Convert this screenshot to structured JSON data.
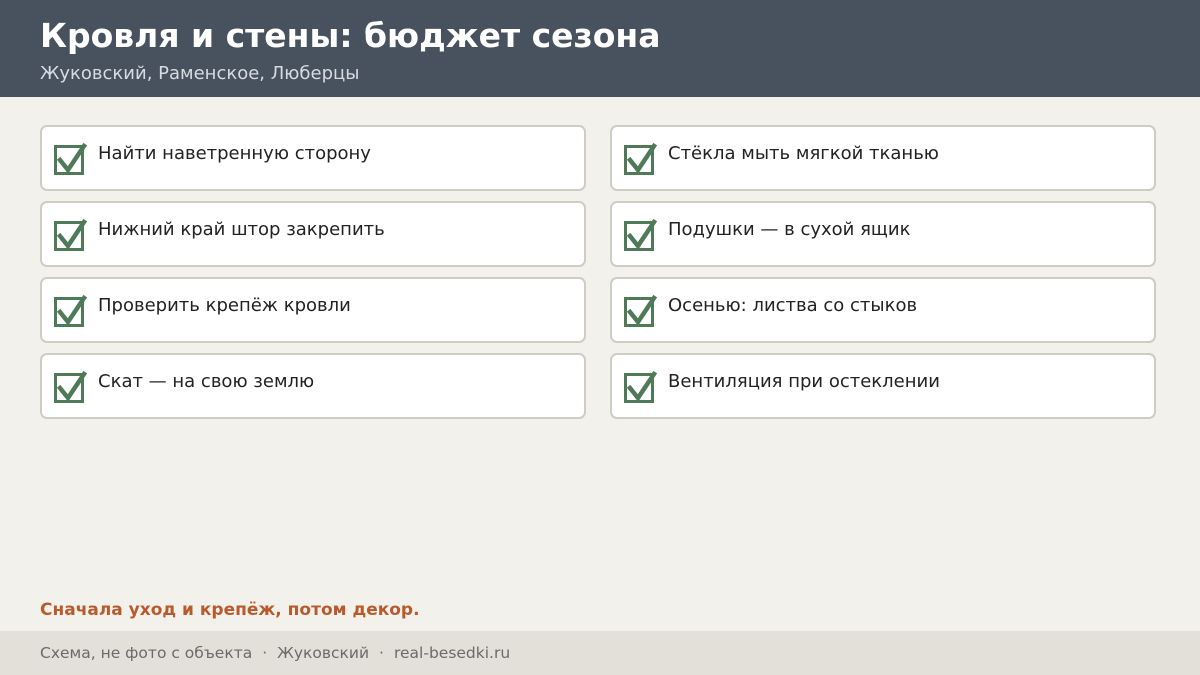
{
  "header": {
    "title": "Кровля и стены: бюджет сезона",
    "subtitle": "Жуковский, Раменское, Люберцы"
  },
  "checklist": {
    "items": [
      {
        "label": "Найти наветренную сторону",
        "checked": true
      },
      {
        "label": "Стёкла мыть мягкой тканью",
        "checked": true
      },
      {
        "label": "Нижний край штор закрепить",
        "checked": true
      },
      {
        "label": "Подушки — в сухой ящик",
        "checked": true
      },
      {
        "label": "Проверить крепёж кровли",
        "checked": true
      },
      {
        "label": "Осенью: листва со стыков",
        "checked": true
      },
      {
        "label": "Скат — на свою землю",
        "checked": true
      },
      {
        "label": "Вентиляция при остеклении",
        "checked": true
      }
    ]
  },
  "note": {
    "text": "Сначала уход и крепёж, потом декор."
  },
  "footer": {
    "disclaimer": "Схема, не фото с объекта",
    "separator": "·",
    "city": "Жуковский",
    "site": "real-besedki.ru"
  },
  "colors": {
    "header_bg": "#48515e",
    "check_green": "#4f7a58",
    "accent": "#b85a2c",
    "page_bg": "#f3f1ec",
    "footer_bg": "#e3e0da"
  },
  "icons": {
    "checkbox": "checkbox-checked-icon"
  }
}
